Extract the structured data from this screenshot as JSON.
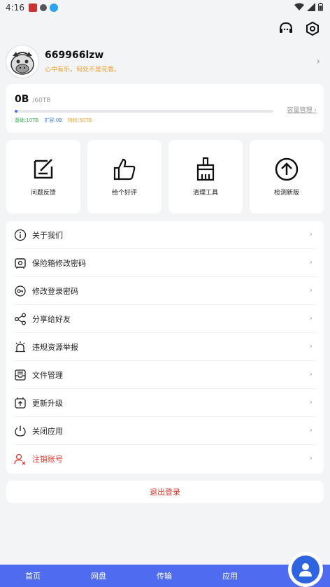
{
  "status_bar": {
    "time": "4:16"
  },
  "profile": {
    "username": "669966lzw",
    "motto": "心中有乐，何处不是花香。"
  },
  "storage": {
    "used": "0B",
    "total": "/60TB",
    "used_fraction": 0.005,
    "legend": {
      "base": "基础:10TB",
      "expand": "扩容:0B",
      "privilege": "特权:50TB"
    },
    "manage_link": "容量管理"
  },
  "quick_actions": [
    {
      "label": "问题反馈",
      "icon": "feedback-icon"
    },
    {
      "label": "给个好评",
      "icon": "thumbs-up-icon"
    },
    {
      "label": "清理工具",
      "icon": "broom-icon"
    },
    {
      "label": "检测新版",
      "icon": "upload-circle-icon"
    }
  ],
  "menu": [
    {
      "label": "关于我们",
      "icon": "info-icon"
    },
    {
      "label": "保险箱修改密码",
      "icon": "safe-icon"
    },
    {
      "label": "修改登录密码",
      "icon": "key-icon"
    },
    {
      "label": "分享给好友",
      "icon": "share-icon"
    },
    {
      "label": "违规资源举报",
      "icon": "alarm-icon"
    },
    {
      "label": "文件管理",
      "icon": "inbox-icon"
    },
    {
      "label": "更新升级",
      "icon": "update-icon"
    },
    {
      "label": "关闭应用",
      "icon": "power-icon"
    },
    {
      "label": "注销账号",
      "icon": "user-remove-icon"
    }
  ],
  "logout_label": "退出登录",
  "tabs": [
    "首页",
    "网盘",
    "传输",
    "应用"
  ],
  "colors": {
    "accent": "#4f6bf0",
    "danger": "#e03b30",
    "motto": "#f0a030"
  }
}
